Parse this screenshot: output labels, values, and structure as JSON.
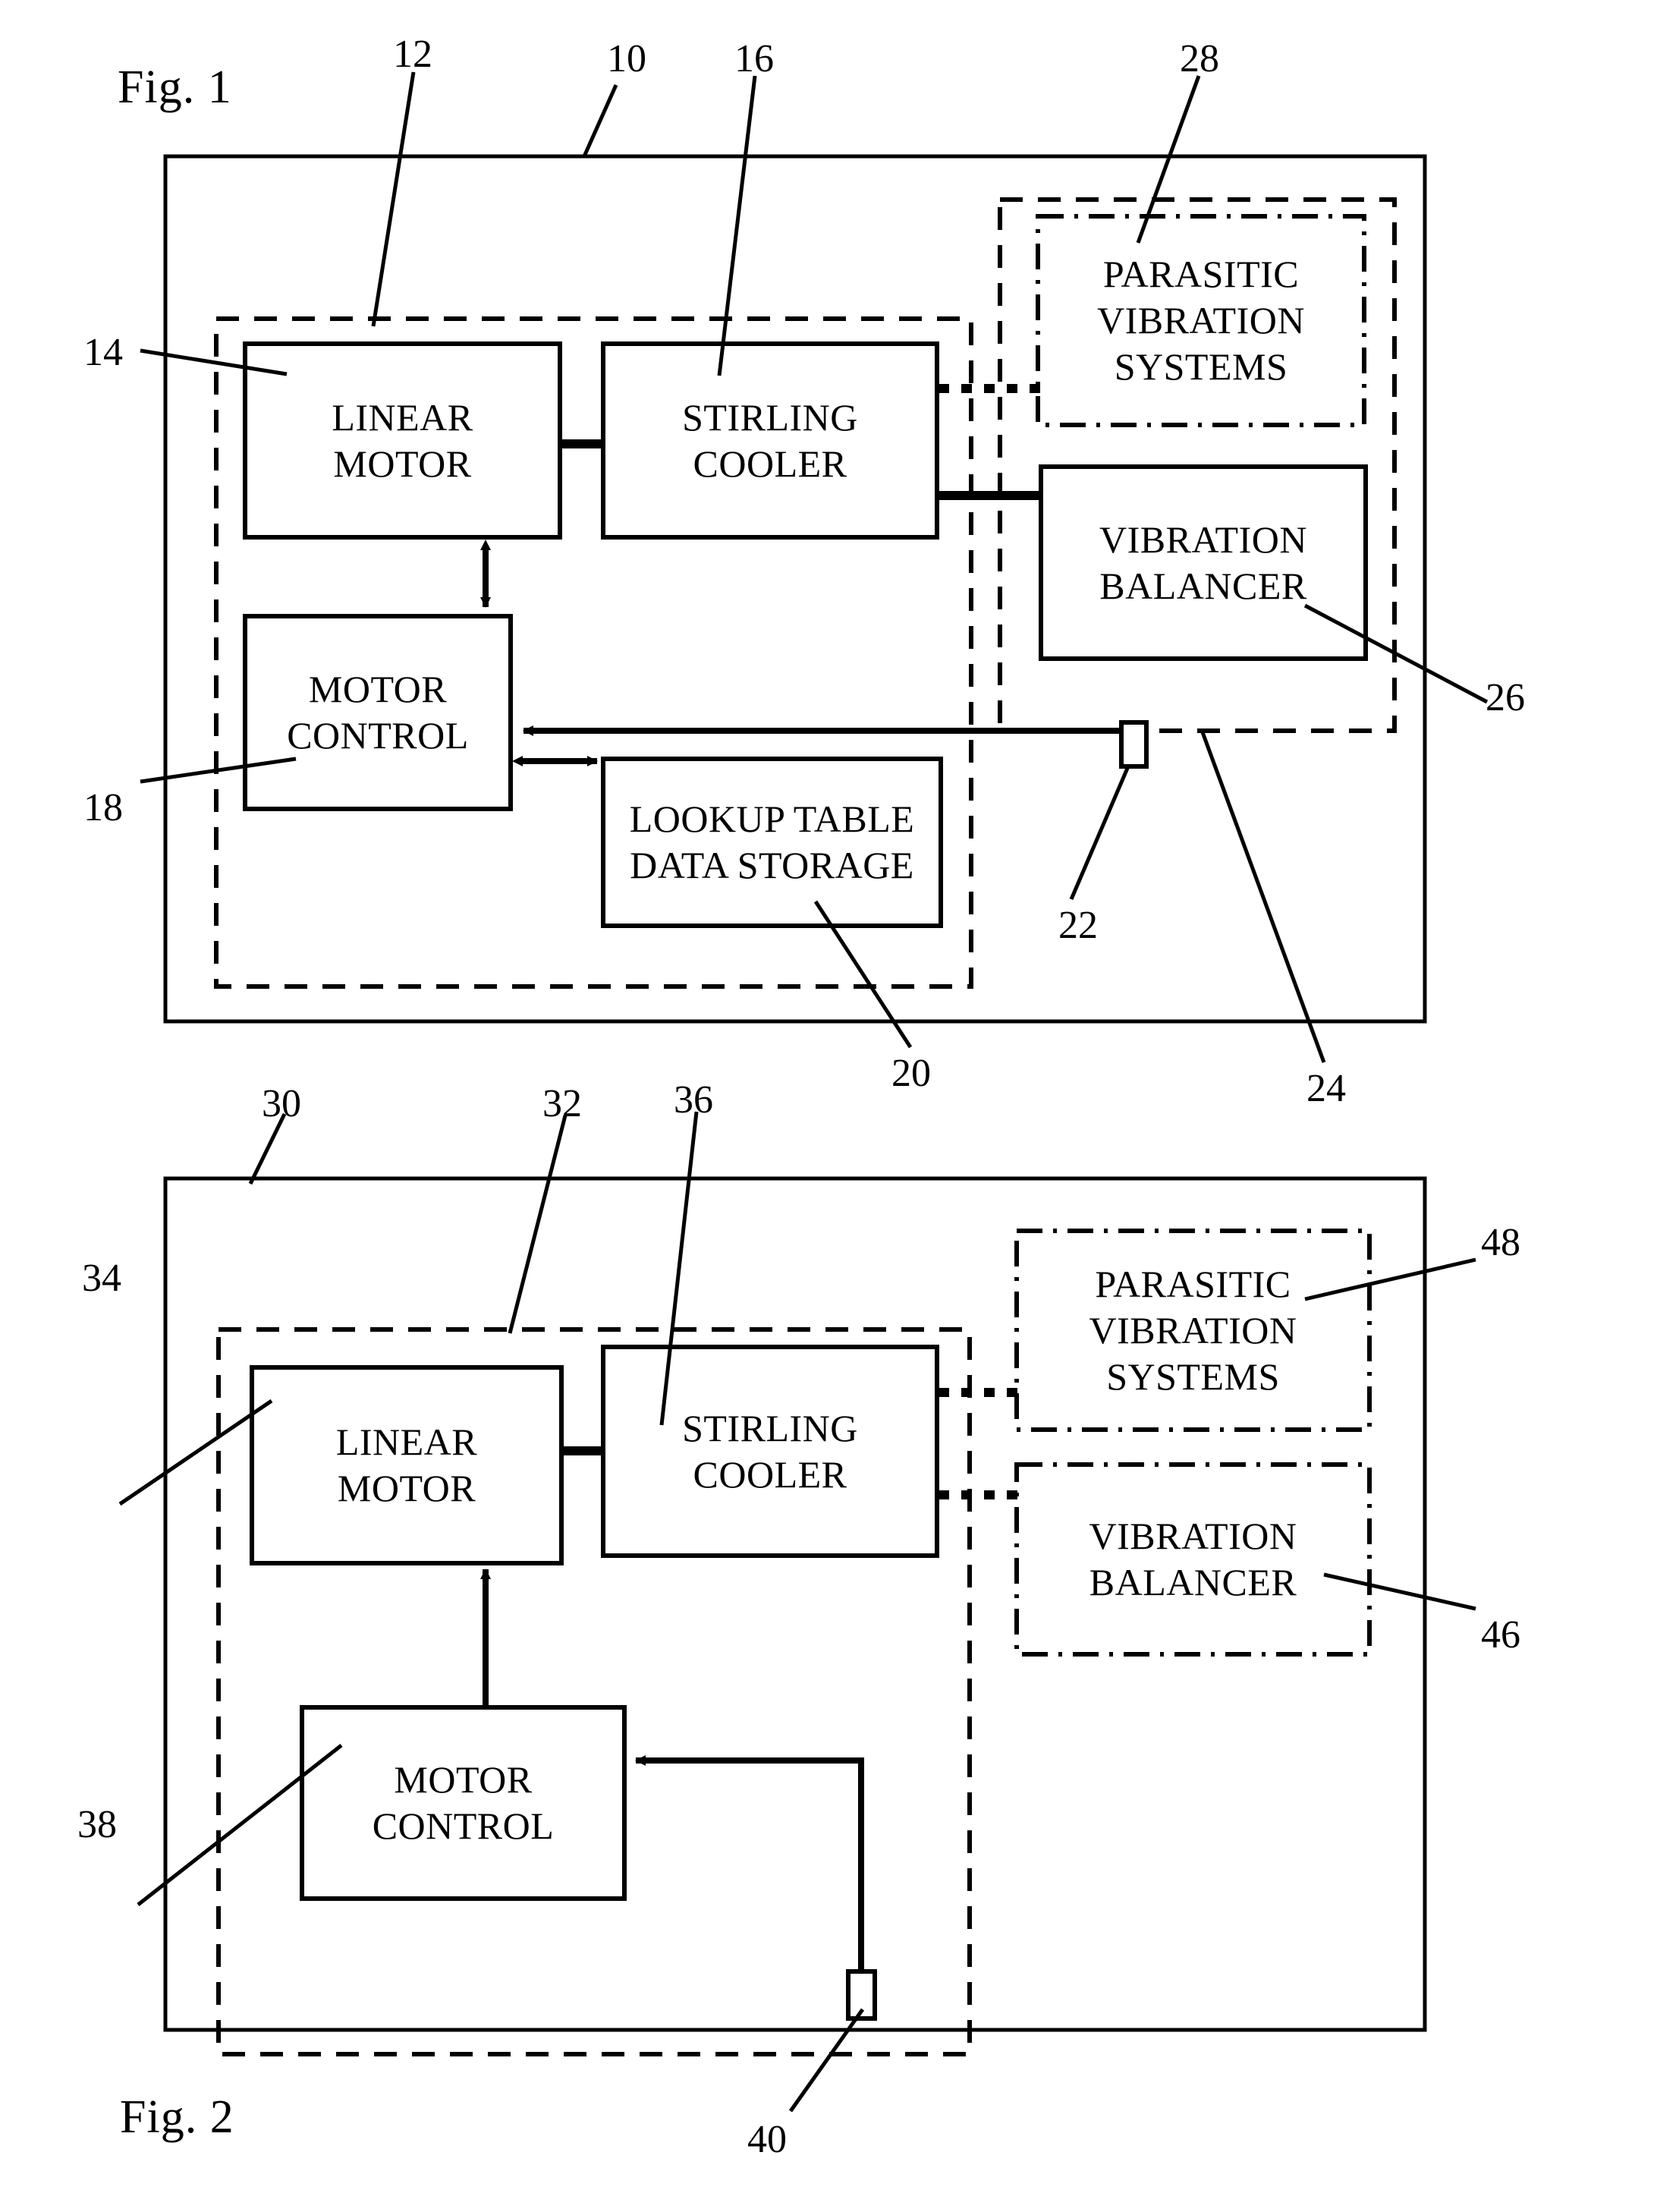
{
  "figures": [
    {
      "id": "fig1",
      "caption": "Fig. 1",
      "outer_ref": "10",
      "inner_ref": "12",
      "blocks": [
        {
          "key": "linear_motor",
          "lines": [
            "LINEAR",
            "MOTOR"
          ],
          "ref": "14",
          "style": "solid"
        },
        {
          "key": "stirling_cooler",
          "lines": [
            "STIRLING",
            "COOLER"
          ],
          "ref": "16",
          "style": "solid"
        },
        {
          "key": "motor_control",
          "lines": [
            "MOTOR",
            "CONTROL"
          ],
          "ref": "18",
          "style": "solid"
        },
        {
          "key": "lookup_table",
          "lines": [
            "LOOKUP TABLE",
            "DATA STORAGE"
          ],
          "ref": "20",
          "style": "solid"
        },
        {
          "key": "parasitic",
          "lines": [
            "PARASITIC",
            "VIBRATION",
            "SYSTEMS"
          ],
          "ref": "28",
          "style": "dash-dot"
        },
        {
          "key": "balancer",
          "lines": [
            "VIBRATION",
            "BALANCER"
          ],
          "ref": "26",
          "style": "solid"
        }
      ],
      "group_ref": "24",
      "sensor_ref": "22"
    },
    {
      "id": "fig2",
      "caption": "Fig. 2",
      "outer_ref": "30",
      "inner_ref": "32",
      "blocks": [
        {
          "key": "linear_motor",
          "lines": [
            "LINEAR",
            "MOTOR"
          ],
          "ref": "34",
          "style": "solid"
        },
        {
          "key": "stirling_cooler",
          "lines": [
            "STIRLING",
            "COOLER"
          ],
          "ref": "36",
          "style": "solid"
        },
        {
          "key": "motor_control",
          "lines": [
            "MOTOR",
            "CONTROL"
          ],
          "ref": "38",
          "style": "solid"
        },
        {
          "key": "parasitic",
          "lines": [
            "PARASITIC",
            "VIBRATION",
            "SYSTEMS"
          ],
          "ref": "48",
          "style": "dash-dot"
        },
        {
          "key": "balancer",
          "lines": [
            "VIBRATION",
            "BALANCER"
          ],
          "ref": "46",
          "style": "dash-dot"
        }
      ],
      "sensor_ref": "40"
    }
  ],
  "labels": {
    "fig1_caption": "Fig. 1",
    "fig2_caption": "Fig. 2",
    "linear_motor_l1": "LINEAR",
    "linear_motor_l2": "MOTOR",
    "stirling_l1": "STIRLING",
    "stirling_l2": "COOLER",
    "motor_control_l1": "MOTOR",
    "motor_control_l2": "CONTROL",
    "lookup_l1": "LOOKUP TABLE",
    "lookup_l2": "DATA STORAGE",
    "parasitic_l1": "PARASITIC",
    "parasitic_l2": "VIBRATION",
    "parasitic_l3": "SYSTEMS",
    "balancer_l1": "VIBRATION",
    "balancer_l2": "BALANCER",
    "ref_10": "10",
    "ref_12": "12",
    "ref_14": "14",
    "ref_16": "16",
    "ref_18": "18",
    "ref_20": "20",
    "ref_22": "22",
    "ref_24": "24",
    "ref_26": "26",
    "ref_28": "28",
    "ref_30": "30",
    "ref_32": "32",
    "ref_34": "34",
    "ref_36": "36",
    "ref_38": "38",
    "ref_40": "40",
    "ref_46": "46",
    "ref_48": "48"
  },
  "colors": {
    "ink": "#000000",
    "paper": "#ffffff"
  }
}
